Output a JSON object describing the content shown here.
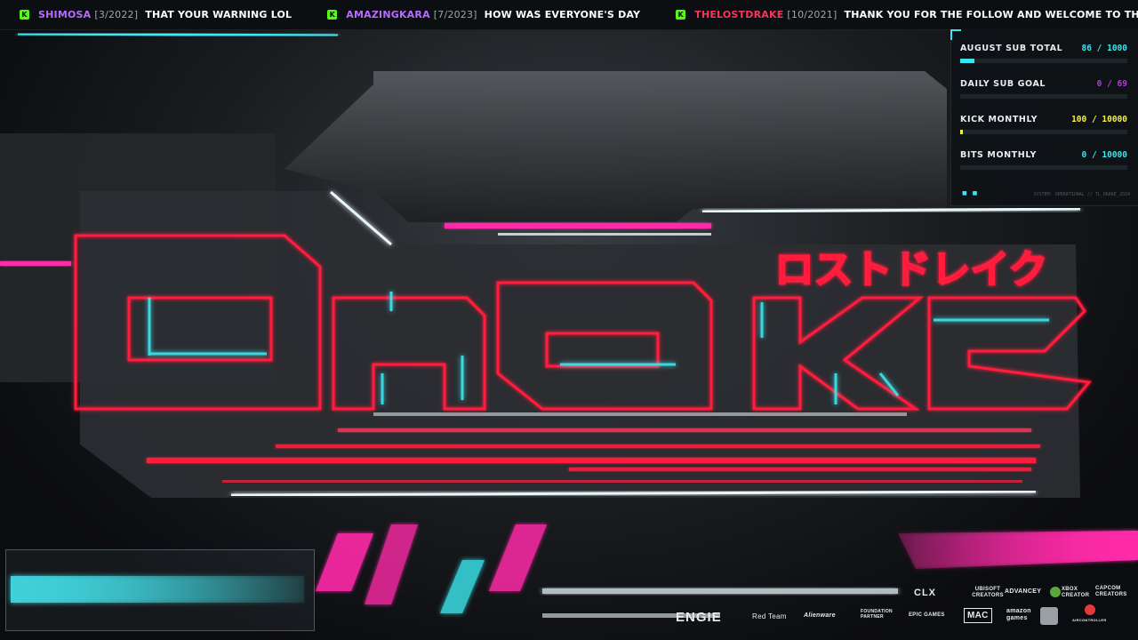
{
  "ticker": {
    "items": [
      {
        "user": "SHIMOSA",
        "date": "[3/2022]",
        "message": "THAT YOUR WARNING LOL",
        "color": "#b86bff"
      },
      {
        "user": "AMAZINGKARA",
        "date": "[7/2023]",
        "message": "HOW WAS EVERYONE'S DAY",
        "color": "#b86bff"
      },
      {
        "user": "THELOSTDRAKE",
        "date": "[10/2021]",
        "message": "THANK YOU FOR THE FOLLOW AND WELCOME TO THE LOST CITY COMMUNITY! @",
        "color": "#ff2f5f"
      }
    ],
    "platform_icon": "kick-icon",
    "platform_letter": "K"
  },
  "goals": [
    {
      "title": "AUGUST SUB TOTAL",
      "value": "86 / 1000",
      "fraction": 0.086,
      "color": "#39e6ef"
    },
    {
      "title": "DAILY SUB GOAL",
      "value": "0 / 69",
      "fraction": 0.0,
      "color": "#b03fd8"
    },
    {
      "title": "KICK MONTHLY",
      "value": "100 / 10000",
      "fraction": 0.01,
      "color": "#f4f04a"
    },
    {
      "title": "BITS MONTHLY",
      "value": "0 / 10000",
      "fraction": 0.0,
      "color": "#39e6ef"
    }
  ],
  "goals_footer": {
    "dots": "■ ■",
    "status": "SYSTEM: OPERATIONAL // TL_DRAKE_2024"
  },
  "logo": {
    "wordmark": "DRAKE",
    "katakana": "ロストドレイク",
    "colors": {
      "primary": "#ff1f3d",
      "accent": "#3ee9f2",
      "magenta": "#ff2aa8"
    }
  },
  "sponsors": {
    "row1": [
      "CLX",
      "UBISOFT CREATORS",
      "ADVANCEY",
      "XBOX CREATOR",
      "CAPCOM CREATORS"
    ],
    "row2": [
      "ENGIE",
      "Red Team",
      "Alienware",
      "FOUNDATION PARTNER",
      "EPIC GAMES",
      "MAC",
      "amazon games",
      "AMD",
      "AIRCONTROLLER"
    ]
  }
}
